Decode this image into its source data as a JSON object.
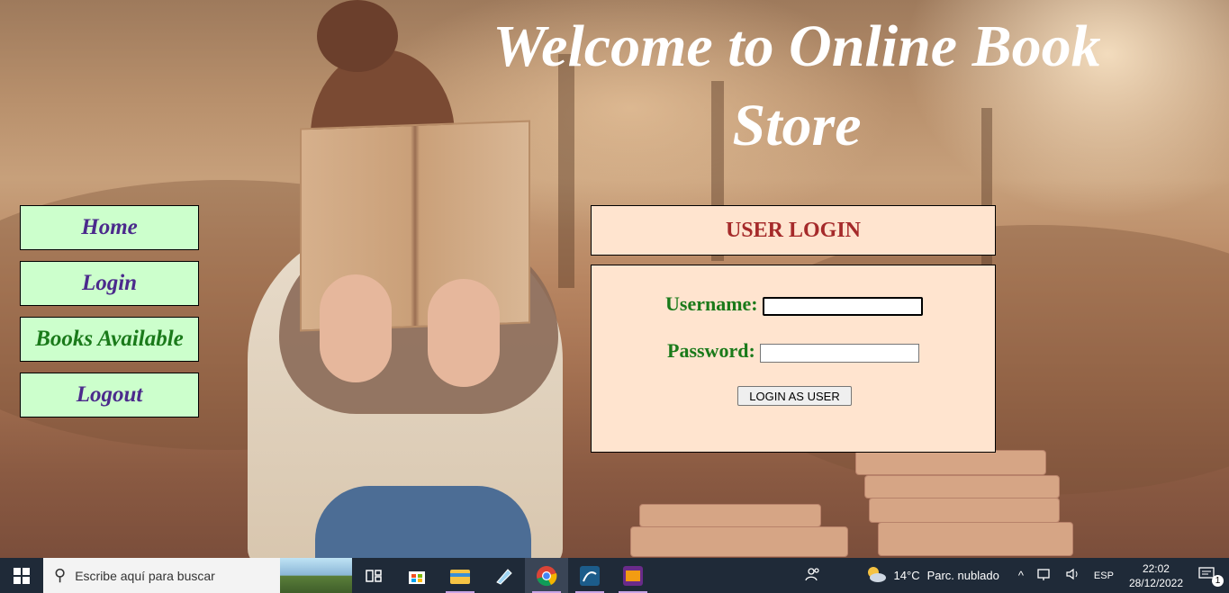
{
  "page": {
    "title": "Welcome to Online Book Store"
  },
  "nav": {
    "items": [
      {
        "label": "Home"
      },
      {
        "label": "Login"
      },
      {
        "label": "Books Available"
      },
      {
        "label": "Logout"
      }
    ]
  },
  "login": {
    "heading": "USER LOGIN",
    "username_label": "Username:",
    "username_value": "",
    "password_label": "Password:",
    "password_value": "",
    "submit_label": "LOGIN AS USER"
  },
  "taskbar": {
    "search_placeholder": "Escribe aquí para buscar",
    "weather_temp": "14°C",
    "weather_text": "Parc. nublado",
    "language": "ESP",
    "time": "22:02",
    "date": "28/12/2022",
    "notification_count": "1",
    "icons": [
      "task-view-icon",
      "microsoft-store-icon",
      "file-explorer-icon",
      "notepad-icon",
      "chrome-icon",
      "mysql-workbench-icon",
      "xampp-icon"
    ]
  },
  "colors": {
    "nav_bg": "#ccffcc",
    "nav_text": "#4b2a8c",
    "login_bg": "#ffe4cf",
    "login_heading": "#a52a2a",
    "label_green": "#1a7a1a",
    "taskbar_bg": "#1f2a38"
  }
}
